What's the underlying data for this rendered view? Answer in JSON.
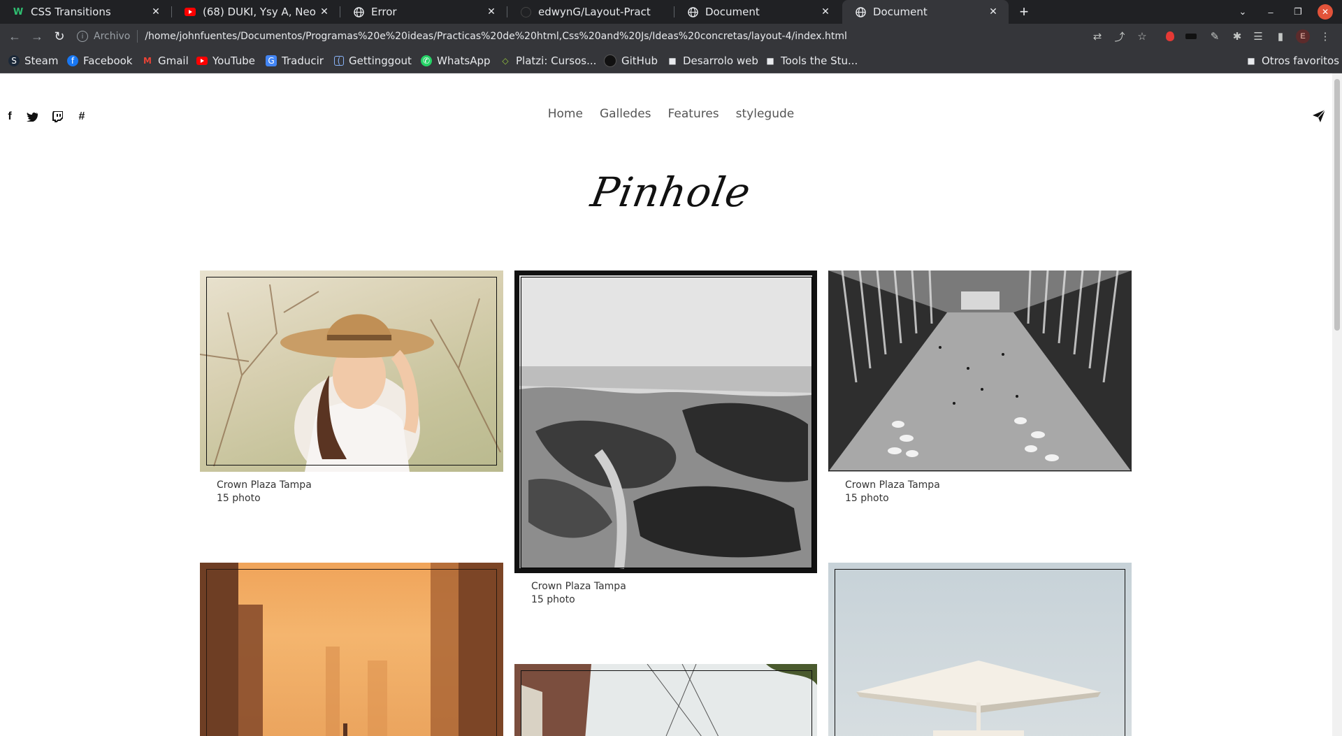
{
  "browser": {
    "tabs": [
      {
        "title": "CSS Transitions",
        "icon": "w-logo-icon"
      },
      {
        "title": "(68) DUKI, Ysy A, Neo Pistea",
        "icon": "youtube-icon"
      },
      {
        "title": "Error",
        "icon": "globe-icon"
      },
      {
        "title": "edwynG/Layout-Practicas",
        "icon": "github-icon"
      },
      {
        "title": "Document",
        "icon": "globe-icon"
      },
      {
        "title": "Document",
        "icon": "globe-icon",
        "active": true
      }
    ],
    "address": {
      "scheme_label": "Archivo",
      "url": "/home/johnfuentes/Documentos/Programas%20e%20ideas/Practicas%20de%20html,Css%20and%20Js/Ideas%20concretas/layout-4/index.html"
    },
    "profile_initial": "E",
    "bookmarks": [
      {
        "label": "Steam",
        "icon": "steam-icon"
      },
      {
        "label": "Facebook",
        "icon": "facebook-icon"
      },
      {
        "label": "Gmail",
        "icon": "gmail-icon"
      },
      {
        "label": "YouTube",
        "icon": "youtube-icon"
      },
      {
        "label": "Traducir",
        "icon": "translate-icon"
      },
      {
        "label": "Gettinggout",
        "icon": "gettinggout-icon"
      },
      {
        "label": "WhatsApp",
        "icon": "whatsapp-icon"
      },
      {
        "label": "Platzi: Cursos...",
        "icon": "platzi-icon"
      },
      {
        "label": "GitHub",
        "icon": "github-icon"
      },
      {
        "label": "Desarrolo web",
        "icon": "folder-icon"
      },
      {
        "label": "Tools  the Stu...",
        "icon": "folder-icon"
      }
    ],
    "other_bookmarks": "Otros favoritos"
  },
  "site": {
    "social_icons": [
      "facebook-icon",
      "twitter-icon",
      "twitch-icon",
      "hashtag-icon"
    ],
    "nav": [
      "Home",
      "Galledes",
      "Features",
      "stylegude"
    ],
    "logo": "Pinhole",
    "cards": [
      {
        "title": "Crown Plaza Tampa",
        "count": "15 photo",
        "image": "woman-in-hat"
      },
      {
        "title": "Crown Plaza Tampa",
        "count": "15 photo",
        "image": "rocky-shore"
      },
      {
        "title": "Crown Plaza Tampa",
        "count": "15 photo",
        "image": "oculus-hall"
      },
      {
        "image": "city-sunset"
      },
      {
        "image": "street-wires"
      },
      {
        "image": "parasol"
      }
    ]
  }
}
